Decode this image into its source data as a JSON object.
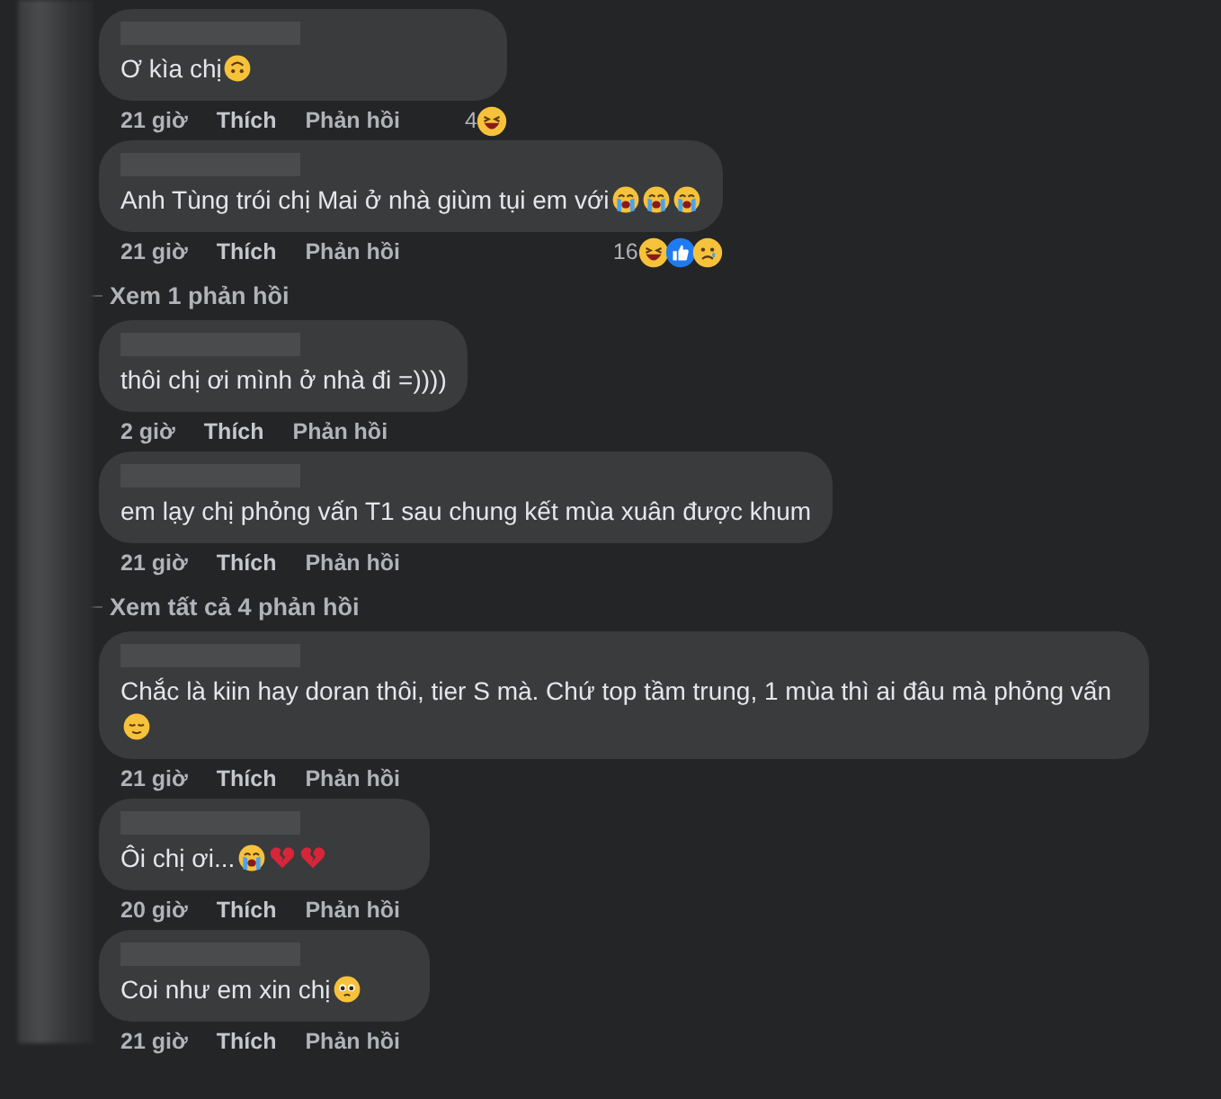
{
  "thread": [
    {
      "kind": "comment",
      "text": "Ơ kìa chị",
      "emojis": [
        {
          "kind": "upside-down"
        }
      ],
      "time": "21 giờ",
      "like": "Thích",
      "reply": "Phản hồi",
      "reaction_count": "4",
      "reactions": [
        {
          "kind": "haha"
        }
      ]
    },
    {
      "kind": "comment",
      "text": "Anh Tùng trói chị Mai ở nhà giùm tụi em với",
      "emojis": [
        {
          "kind": "crying"
        },
        {
          "kind": "crying"
        },
        {
          "kind": "crying"
        }
      ],
      "time": "21 giờ",
      "like": "Thích",
      "reply": "Phản hồi",
      "reaction_count": "16",
      "reactions": [
        {
          "kind": "haha"
        },
        {
          "kind": "like"
        },
        {
          "kind": "sad"
        }
      ]
    },
    {
      "kind": "replies-link",
      "text": "Xem 1 phản hồi"
    },
    {
      "kind": "comment",
      "text": "thôi chị ơi mình ở nhà đi =))))",
      "time": "2 giờ",
      "like": "Thích",
      "reply": "Phản hồi"
    },
    {
      "kind": "comment",
      "text": "em lạy chị phỏng vấn T1 sau chung kết mùa xuân được khum",
      "time": "21 giờ",
      "like": "Thích",
      "reply": "Phản hồi"
    },
    {
      "kind": "replies-link",
      "text": "Xem tất cả 4 phản hồi"
    },
    {
      "kind": "comment",
      "text": "Chắc là kiin hay doran thôi, tier S mà. Chứ top tầm trung, 1 mùa thì ai đâu mà phỏng vấn",
      "emojis": [
        {
          "kind": "relieved"
        }
      ],
      "time": "21 giờ",
      "like": "Thích",
      "reply": "Phản hồi"
    },
    {
      "kind": "comment",
      "text": "Ôi chị ơi...",
      "emojis": [
        {
          "kind": "crying"
        },
        {
          "kind": "broken-heart"
        },
        {
          "kind": "broken-heart"
        }
      ],
      "time": "20 giờ",
      "like": "Thích",
      "reply": "Phản hồi"
    },
    {
      "kind": "comment",
      "text": "Coi như em xin chị",
      "emojis": [
        {
          "kind": "pleading"
        }
      ],
      "time": "21 giờ",
      "like": "Thích",
      "reply": "Phản hồi"
    }
  ]
}
